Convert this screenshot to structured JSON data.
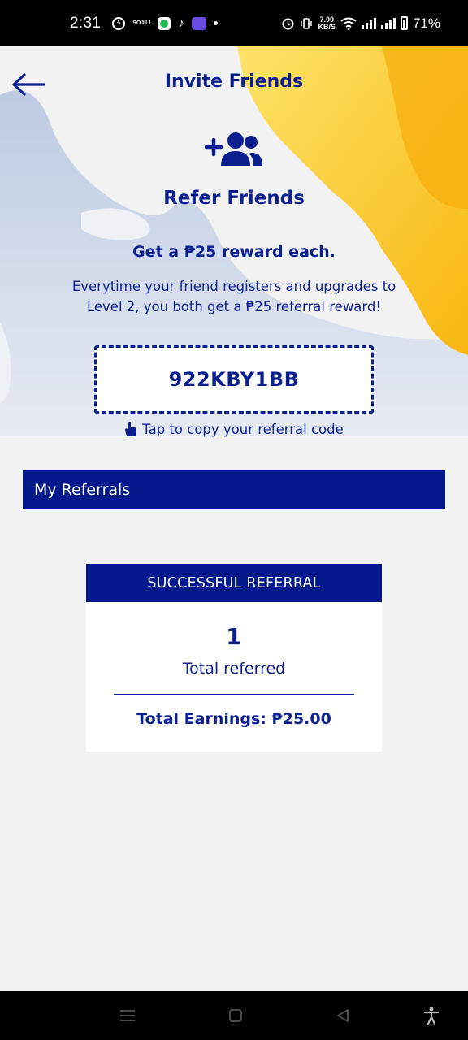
{
  "status_bar": {
    "time": "2:31",
    "app_badge_text": "SOJILI",
    "net_speed_value": "7.00",
    "net_speed_unit": "KB/S",
    "battery": "71%"
  },
  "header": {
    "title": "Invite Friends"
  },
  "refer": {
    "title": "Refer Friends",
    "reward_headline": "Get a ₱25 reward each.",
    "reward_description": "Everytime your friend registers and upgrades to Level 2, you both get a ₱25 referral reward!",
    "referral_code": "922KBY1BB",
    "copy_hint": "Tap to copy your referral code"
  },
  "my_referrals": {
    "section_label": "My Referrals",
    "card_header": "SUCCESSFUL REFERRAL",
    "count": "1",
    "count_label": "Total referred",
    "earnings": "Total Earnings: ₱25.00"
  },
  "colors": {
    "primary": "#041a8c",
    "text": "#0b1f8f",
    "accent_yellow": "#fbc21a",
    "background": "#f2f2f2"
  },
  "icons": {
    "back": "arrow-left-icon",
    "refer": "add-user-group-icon",
    "copy": "hand-pointer-icon"
  }
}
